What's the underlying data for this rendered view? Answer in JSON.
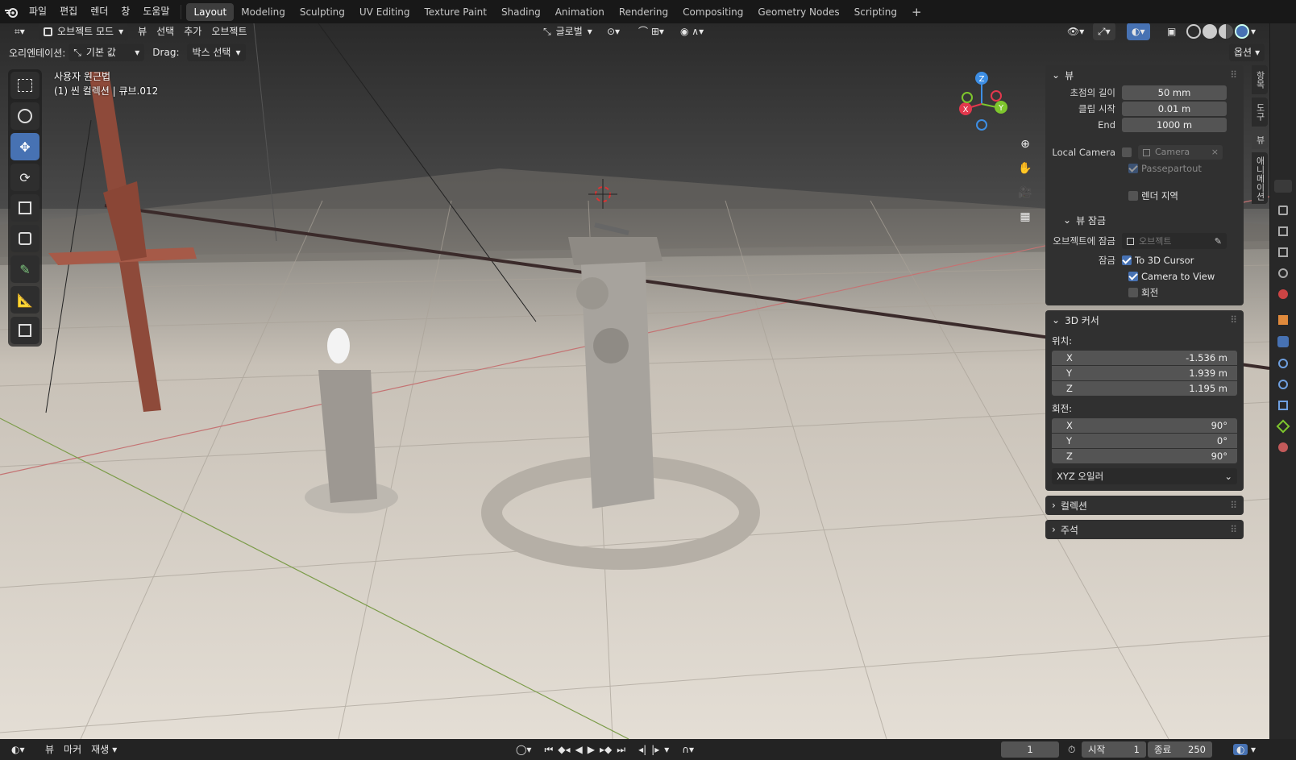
{
  "topbar": {
    "menus": [
      "파일",
      "편집",
      "렌더",
      "창",
      "도움말"
    ],
    "workspaces": [
      "Layout",
      "Modeling",
      "Sculpting",
      "UV Editing",
      "Texture Paint",
      "Shading",
      "Animation",
      "Rendering",
      "Compositing",
      "Geometry Nodes",
      "Scripting"
    ],
    "active_workspace": "Layout",
    "add_tab": "+"
  },
  "viewport_header": {
    "mode": "오브젝트 모드",
    "menus": [
      "뷰",
      "선택",
      "추가",
      "오브젝트"
    ],
    "transform_orientation": "글로벌",
    "options_label": "옵션"
  },
  "tool_settings": {
    "orientation_label": "오리엔테이션:",
    "orientation_value": "기본 값",
    "drag_label": "Drag:",
    "drag_value": "박스 선택"
  },
  "overlay_text": {
    "view_name": "사용자 원근법",
    "collection_info": "(1) 씬 컬렉션 | 큐브.012"
  },
  "gizmo": {
    "x": "X",
    "y": "Y",
    "z": "Z"
  },
  "npanel": {
    "view": {
      "title": "뷰",
      "focal_label": "초점의 길이",
      "focal_value": "50 mm",
      "clip_start_label": "클립 시작",
      "clip_start_value": "0.01 m",
      "clip_end_label": "End",
      "clip_end_value": "1000 m",
      "local_camera_label": "Local Camera",
      "camera_placeholder": "Camera",
      "passepartout": "Passepartout",
      "render_region": "렌더 지역",
      "view_lock_title": "뷰 잠금",
      "lock_object_label": "오브젝트에 잠금",
      "lock_object_placeholder": "오브젝트",
      "lock_label": "잠금",
      "to_3d_cursor": "To 3D Cursor",
      "camera_to_view": "Camera to View",
      "rotation": "회전"
    },
    "cursor": {
      "title": "3D 커서",
      "location_label": "위치:",
      "loc": [
        {
          "axis": "X",
          "value": "-1.536 m"
        },
        {
          "axis": "Y",
          "value": "1.939 m"
        },
        {
          "axis": "Z",
          "value": "1.195 m"
        }
      ],
      "rotation_label": "회전:",
      "rot": [
        {
          "axis": "X",
          "value": "90°"
        },
        {
          "axis": "Y",
          "value": "0°"
        },
        {
          "axis": "Z",
          "value": "90°"
        }
      ],
      "rotation_mode": "XYZ 오일러"
    },
    "collection_title": "컬렉션",
    "annotation_title": "주석",
    "tabs": [
      "항목",
      "도구",
      "뷰",
      "애니메이션"
    ]
  },
  "timeline": {
    "menus": [
      "뷰",
      "마커",
      "재생"
    ],
    "current_frame": "1",
    "start_label": "시작",
    "start_value": "1",
    "end_label": "종료",
    "end_value": "250"
  },
  "colors": {
    "accent": "#4772b3",
    "x_axis": "#e2384d",
    "y_axis": "#7ec62d",
    "z_axis": "#3d8ee4"
  }
}
